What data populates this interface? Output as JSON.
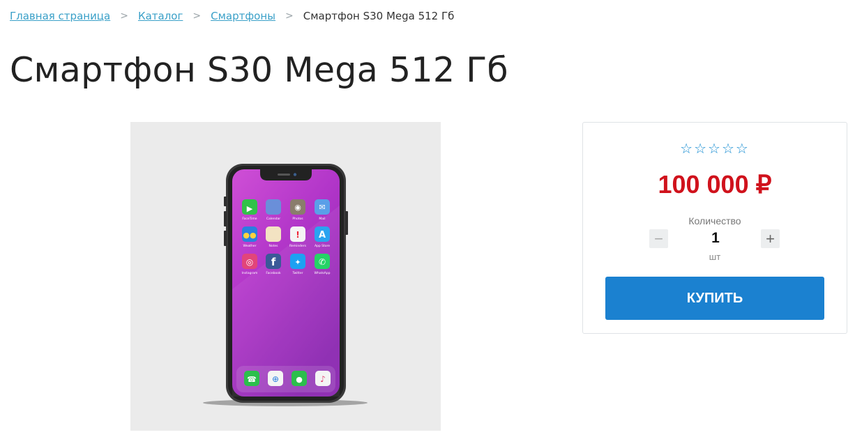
{
  "breadcrumb": {
    "items": [
      "Главная страница",
      "Каталог",
      "Смартфоны"
    ],
    "current": "Смартфон S30 Mega 512 Гб",
    "separator": ">"
  },
  "title": "Смартфон S30 Mega 512 Гб",
  "product_image": {
    "apps": [
      "FaceTime",
      "Calendar",
      "Photos",
      "Mail",
      "Weather",
      "Notes",
      "Reminders",
      "App Store",
      "Instagram",
      "Facebook",
      "Twitter",
      "WhatsApp"
    ],
    "dock_icons": [
      "phone-icon",
      "safari-icon",
      "messages-icon",
      "music-icon"
    ]
  },
  "buy_card": {
    "rating": {
      "value": 0,
      "max": 5,
      "icon": "star-outline-icon"
    },
    "price": "100 000 ₽",
    "quantity_label": "Количество",
    "quantity": "1",
    "unit": "шт",
    "minus": "−",
    "plus": "+",
    "buy_label": "КУПИТЬ"
  },
  "colors": {
    "link": "#3aa0c8",
    "price": "#d0121c",
    "accent": "#1b81d0",
    "stars": "#1b8fd3"
  }
}
